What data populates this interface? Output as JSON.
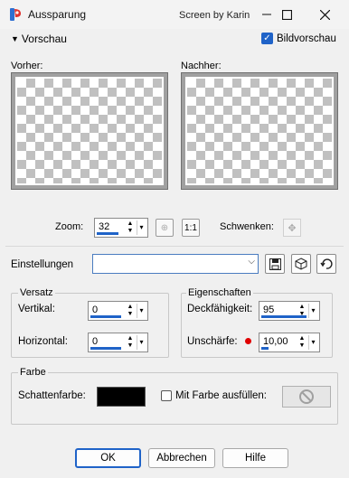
{
  "window": {
    "title": "Aussparung",
    "subtitle": "Screen by Karin",
    "minimize_icon": "minimize-icon",
    "maximize_icon": "maximize-icon",
    "close_icon": "close-icon"
  },
  "preview": {
    "toggle_label": "Vorschau",
    "bild_label": "Bildvorschau",
    "bild_checked": true,
    "vorher_label": "Vorher:",
    "nachher_label": "Nachher:"
  },
  "zoom": {
    "label": "Zoom:",
    "value": "32",
    "pan_label": "Schwenken:"
  },
  "settings": {
    "label": "Einstellungen",
    "preset_value": ""
  },
  "versatz": {
    "title": "Versatz",
    "vertical_label": "Vertikal:",
    "vertical_value": "0",
    "horizontal_label": "Horizontal:",
    "horizontal_value": "0"
  },
  "eigenschaften": {
    "title": "Eigenschaften",
    "opacity_label": "Deckfähigkeit:",
    "opacity_value": "95",
    "blur_label": "Unschärfe:",
    "blur_value": "10,00"
  },
  "farbe": {
    "title": "Farbe",
    "shadow_label": "Schattenfarbe:",
    "shadow_color": "#000000",
    "fill_label": "Mit Farbe ausfüllen:",
    "fill_checked": false
  },
  "buttons": {
    "ok": "OK",
    "cancel": "Abbrechen",
    "help": "Hilfe"
  },
  "colors": {
    "accent": "#1f63c8",
    "dot": "#e00000"
  }
}
